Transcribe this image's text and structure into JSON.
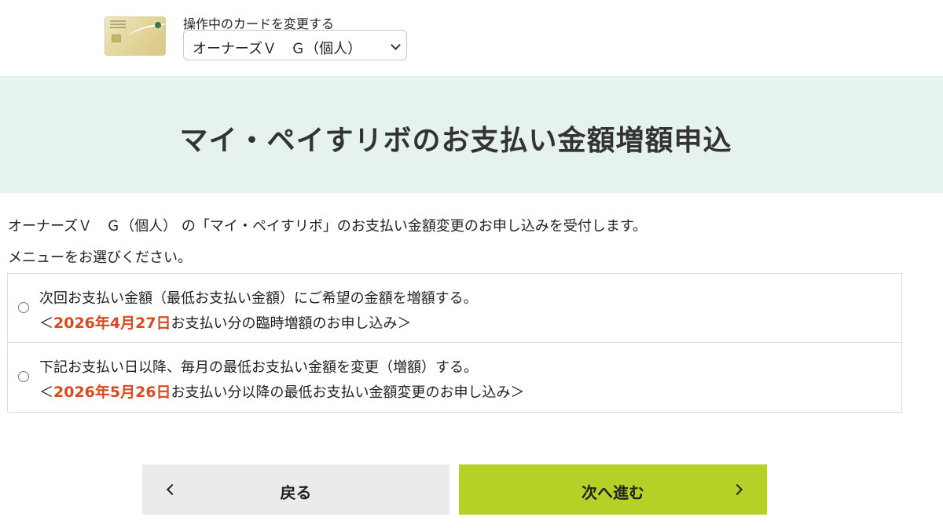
{
  "card": {
    "change_label": "操作中のカードを変更する",
    "selected": "オーナーズＶ　Ｇ（個人）"
  },
  "page": {
    "title": "マイ・ペイすリボのお支払い金額増額申込"
  },
  "intro": "オーナーズＶ　Ｇ（個人） の「マイ・ペイすリボ」のお支払い金額変更のお申し込みを受付します。",
  "menu_prompt": "メニューをお選びください。",
  "options": [
    {
      "line1": "次回お支払い金額（最低お支払い金額）にご希望の金額を増額する。",
      "prefix": "＜",
      "date": "2026年4月27日",
      "suffix": "お支払い分の臨時増額のお申し込み＞"
    },
    {
      "line1": "下記お支払い日以降、毎月の最低お支払い金額を変更（増額）する。",
      "prefix": "＜",
      "date": "2026年5月26日",
      "suffix": "お支払い分以降の最低お支払い金額変更のお申し込み＞"
    }
  ],
  "buttons": {
    "back": "戻る",
    "next": "次へ進む"
  },
  "colors": {
    "title_band": "#e5f2ef",
    "next_button": "#b5d127",
    "back_button": "#ebebeb",
    "date_accent": "#d94a1e"
  }
}
